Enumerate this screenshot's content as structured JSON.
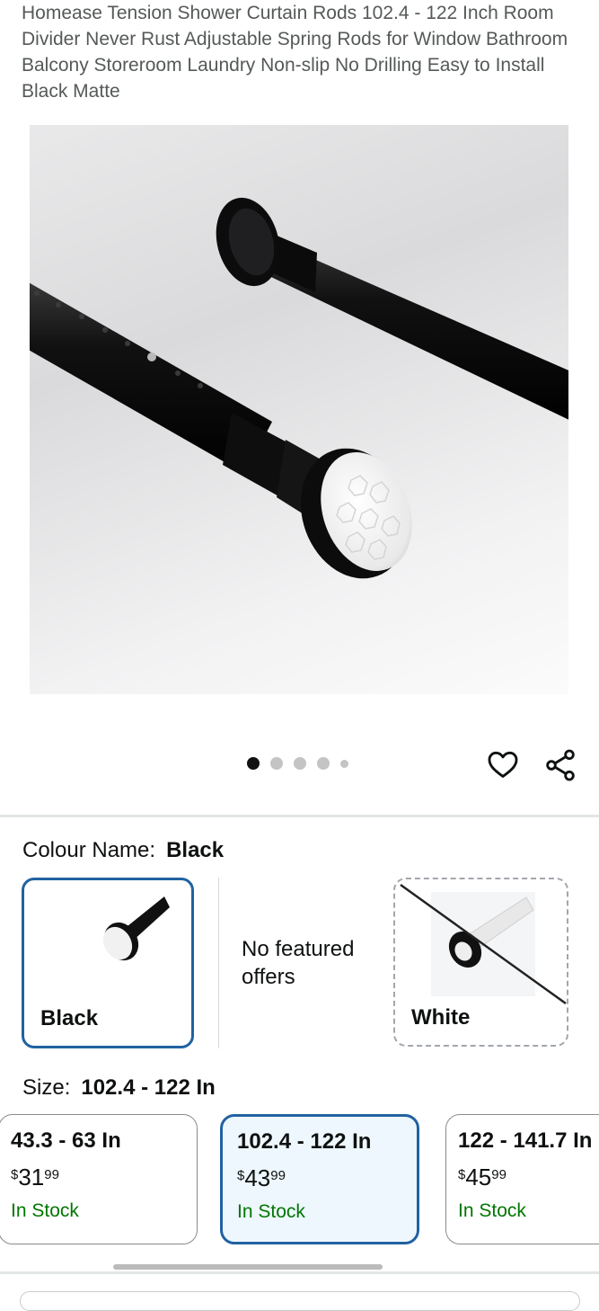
{
  "product": {
    "title": "Homease Tension Shower Curtain Rods 102.4 - 122 Inch Room Divider Never Rust Adjustable Spring Rods for Window Bathroom Balcony Storeroom Laundry Non-slip No Drilling Easy to Install Black Matte"
  },
  "gallery": {
    "image_count": 5,
    "active_index": 0
  },
  "actions": {
    "wishlist_icon": "heart-icon",
    "share_icon": "share-icon"
  },
  "colour": {
    "label": "Colour Name:",
    "selected": "Black",
    "options": [
      {
        "name": "Black",
        "state": "selected"
      },
      {
        "name": "No featured offers",
        "state": "info"
      },
      {
        "name": "White",
        "state": "unavailable"
      }
    ]
  },
  "size": {
    "label": "Size:",
    "selected": "102.4 - 122 In",
    "options": [
      {
        "name": "43.3 - 63 In",
        "symbol": "$",
        "whole": "31",
        "cents": "99",
        "stock": "In Stock"
      },
      {
        "name": "102.4 - 122 In",
        "symbol": "$",
        "whole": "43",
        "cents": "99",
        "stock": "In Stock"
      },
      {
        "name": "122 - 141.7 In",
        "symbol": "$",
        "whole": "45",
        "cents": "99",
        "stock": "In Stock"
      }
    ]
  },
  "colors": {
    "accent": "#2162a1",
    "in_stock": "#007600",
    "selected_bg": "#edf7fd"
  }
}
